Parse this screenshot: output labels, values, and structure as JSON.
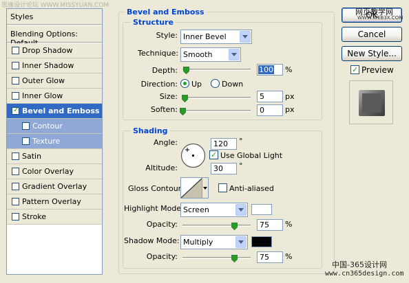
{
  "watermarks": {
    "top_left": "思缘设计论坛  WWW.MISSYUAN.COM",
    "top_right_1": "网页教学网",
    "top_right_2": "WWW.WEB3X.COM",
    "bottom_right_1": "中国-365设计网",
    "bottom_right_2": "www.cn365design.com"
  },
  "styles_panel": {
    "header": "Styles",
    "blending_options": "Blending Options: Default",
    "items": [
      {
        "label": "Drop Shadow",
        "checked": false
      },
      {
        "label": "Inner Shadow",
        "checked": false
      },
      {
        "label": "Outer Glow",
        "checked": false
      },
      {
        "label": "Inner Glow",
        "checked": false
      },
      {
        "label": "Bevel and Emboss",
        "checked": true
      },
      {
        "label": "Contour",
        "checked": false
      },
      {
        "label": "Texture",
        "checked": false
      },
      {
        "label": "Satin",
        "checked": false
      },
      {
        "label": "Color Overlay",
        "checked": false
      },
      {
        "label": "Gradient Overlay",
        "checked": false
      },
      {
        "label": "Pattern Overlay",
        "checked": false
      },
      {
        "label": "Stroke",
        "checked": false
      }
    ]
  },
  "bevel": {
    "title": "Bevel and Emboss",
    "structure": {
      "title": "Structure",
      "style_label": "Style:",
      "style_value": "Inner Bevel",
      "technique_label": "Technique:",
      "technique_value": "Smooth",
      "depth_label": "Depth:",
      "depth_value": "100",
      "depth_unit": "%",
      "depth_level": 0.05,
      "direction_label": "Direction:",
      "direction_up": "Up",
      "direction_down": "Down",
      "size_label": "Size:",
      "size_value": "5",
      "size_unit": "px",
      "soften_label": "Soften:",
      "soften_value": "0",
      "soften_unit": "px"
    },
    "shading": {
      "title": "Shading",
      "angle_label": "Angle:",
      "angle_value": "120",
      "angle_unit": "°",
      "global_light_label": "Use Global Light",
      "altitude_label": "Altitude:",
      "altitude_value": "30",
      "altitude_unit": "°",
      "gloss_contour_label": "Gloss Contour:",
      "anti_aliased_label": "Anti-aliased",
      "highlight_mode_label": "Highlight Mode:",
      "highlight_mode_value": "Screen",
      "highlight_color": "#ffffff",
      "highlight_opacity_label": "Opacity:",
      "highlight_opacity_value": "75",
      "highlight_opacity_unit": "%",
      "shadow_mode_label": "Shadow Mode:",
      "shadow_mode_value": "Multiply",
      "shadow_color": "#000000",
      "shadow_opacity_label": "Opacity:",
      "shadow_opacity_value": "75",
      "shadow_opacity_unit": "%"
    }
  },
  "buttons": {
    "ok": "OK",
    "cancel": "Cancel",
    "new_style": "New Style...",
    "preview_label": "Preview"
  },
  "colors": {
    "selection": "#316AC5",
    "subselection": "#8fa8d6",
    "group_title": "#0046d5",
    "dialog_bg": "#ECE9D8"
  }
}
